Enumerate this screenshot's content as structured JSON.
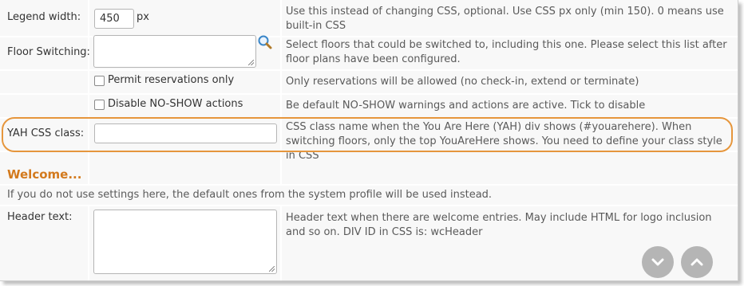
{
  "rows": {
    "legend_width": {
      "label": "Legend width:",
      "value": "450",
      "unit": "px",
      "description": "Use this instead of changing CSS, optional. Use CSS px only (min 150). 0 means use built-in CSS"
    },
    "floor_switching": {
      "label": "Floor Switching:",
      "description": "Select floors that could be switched to, including this one. Please select this list after floor plans have been configured."
    },
    "permit_reservations": {
      "checkbox_label": "Permit reservations only",
      "checked": false,
      "description": "Only reservations will be allowed (no check-in, extend or terminate)"
    },
    "disable_noshow": {
      "checkbox_label": "Disable NO-SHOW actions",
      "checked": false,
      "description": "Be default NO-SHOW warnings and actions are active. Tick to disable"
    },
    "yah_css": {
      "label": "YAH CSS class:",
      "value": "",
      "description": "CSS class name when the You Are Here (YAH) div shows (#youarehere).  When switching floors, only the top YouAreHere shows. You need to define your class style in CSS"
    },
    "header_text": {
      "label": "Header text:",
      "description": "Header text when there are welcome entries. May include HTML for logo inclusion and so on. DIV ID in CSS is: wcHeader"
    }
  },
  "welcome": {
    "title": "Welcome...",
    "info": "If you do not use settings here, the default ones from the system profile will be used instead."
  },
  "icons": {
    "search": "search-icon",
    "scroll_down": "chevron-down-icon",
    "scroll_up": "chevron-up-icon"
  },
  "colors": {
    "accent": "#e6963c",
    "section_title": "#d37a1d",
    "cell_bg": "#f8f8f8",
    "grid_line": "#ffffff"
  }
}
